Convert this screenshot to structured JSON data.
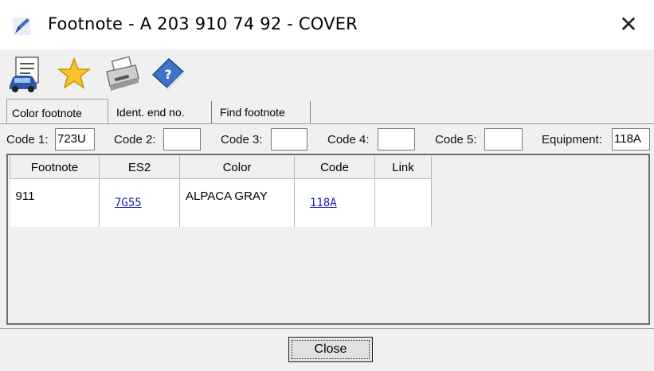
{
  "window": {
    "title": "Footnote - A 203 910 74 92 - COVER",
    "close_glyph": "✕"
  },
  "toolbar": {
    "icons": [
      "car-document-icon",
      "star-icon",
      "printer-icon",
      "help-book-icon"
    ]
  },
  "tabs": [
    {
      "label": "Color footnote",
      "active": true
    },
    {
      "label": "Ident. end no.",
      "active": false
    },
    {
      "label": "Find footnote",
      "active": false
    }
  ],
  "codes": {
    "code1_label": "Code 1:",
    "code1_value": "723U",
    "code2_label": "Code 2:",
    "code2_value": "",
    "code3_label": "Code 3:",
    "code3_value": "",
    "code4_label": "Code 4:",
    "code4_value": "",
    "code5_label": "Code 5:",
    "code5_value": "",
    "equipment_label": "Equipment:",
    "equipment_value": "118A"
  },
  "table": {
    "headers": [
      "Footnote",
      "ES2",
      "Color",
      "Code",
      "Link"
    ],
    "rows": [
      {
        "footnote": "911",
        "es2": "7G55",
        "color": "ALPACA GRAY",
        "code": "118A",
        "link": ""
      }
    ]
  },
  "footer": {
    "close_label": "Close"
  },
  "colors": {
    "link": "#1a1ab0",
    "background": "#f0f0f0",
    "titlebar": "#ffffff"
  }
}
